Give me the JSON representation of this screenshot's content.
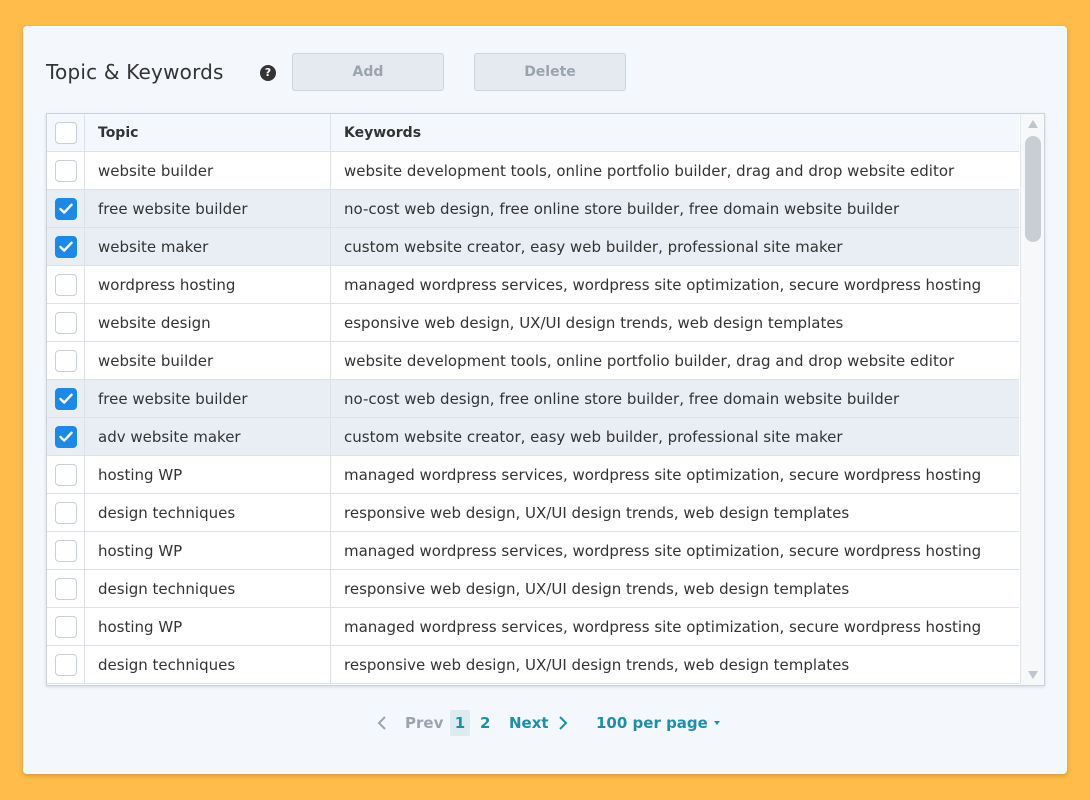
{
  "header": {
    "title": "Topic & Keywords",
    "help_icon": "?",
    "add_label": "Add",
    "delete_label": "Delete"
  },
  "table": {
    "columns": [
      "Topic",
      "Keywords"
    ],
    "rows": [
      {
        "checked": false,
        "topic": "website builder",
        "keywords": "website development tools, online portfolio builder, drag and drop website editor"
      },
      {
        "checked": true,
        "topic": "free website builder",
        "keywords": "no-cost web design, free online store builder, free domain website builder"
      },
      {
        "checked": true,
        "topic": "website maker",
        "keywords": "custom website creator, easy web builder, professional site maker"
      },
      {
        "checked": false,
        "topic": "wordpress hosting",
        "keywords": "managed wordpress services, wordpress site optimization, secure wordpress hosting"
      },
      {
        "checked": false,
        "topic": "website design",
        "keywords": "esponsive web design, UX/UI design trends, web design templates"
      },
      {
        "checked": false,
        "topic": "website builder",
        "keywords": "website development tools, online portfolio builder, drag and drop website editor"
      },
      {
        "checked": true,
        "topic": "free website builder",
        "keywords": "no-cost web design, free online store builder, free domain website builder"
      },
      {
        "checked": true,
        "topic": "adv website maker",
        "keywords": "custom website creator, easy web builder, professional site maker"
      },
      {
        "checked": false,
        "topic": "hosting WP",
        "keywords": "managed wordpress services, wordpress site optimization, secure wordpress hosting"
      },
      {
        "checked": false,
        "topic": "design techniques",
        "keywords": "responsive web design, UX/UI design trends, web design templates"
      },
      {
        "checked": false,
        "topic": "hosting WP",
        "keywords": "managed wordpress services, wordpress site optimization, secure wordpress hosting"
      },
      {
        "checked": false,
        "topic": "design techniques",
        "keywords": "responsive web design, UX/UI design trends, web design templates"
      },
      {
        "checked": false,
        "topic": "hosting WP",
        "keywords": "managed wordpress services, wordpress site optimization, secure wordpress hosting"
      },
      {
        "checked": false,
        "topic": "design techniques",
        "keywords": "responsive web design, UX/UI design trends, web design templates"
      }
    ]
  },
  "pagination": {
    "prev_label": "Prev",
    "pages": [
      "1",
      "2"
    ],
    "current_page": "1",
    "next_label": "Next",
    "per_page_label": "100 per page"
  },
  "colors": {
    "background": "#FFBC4A",
    "accent": "#1D8FA6",
    "checkbox_checked": "#1E88E5",
    "selected_row": "#E9EEF5"
  }
}
